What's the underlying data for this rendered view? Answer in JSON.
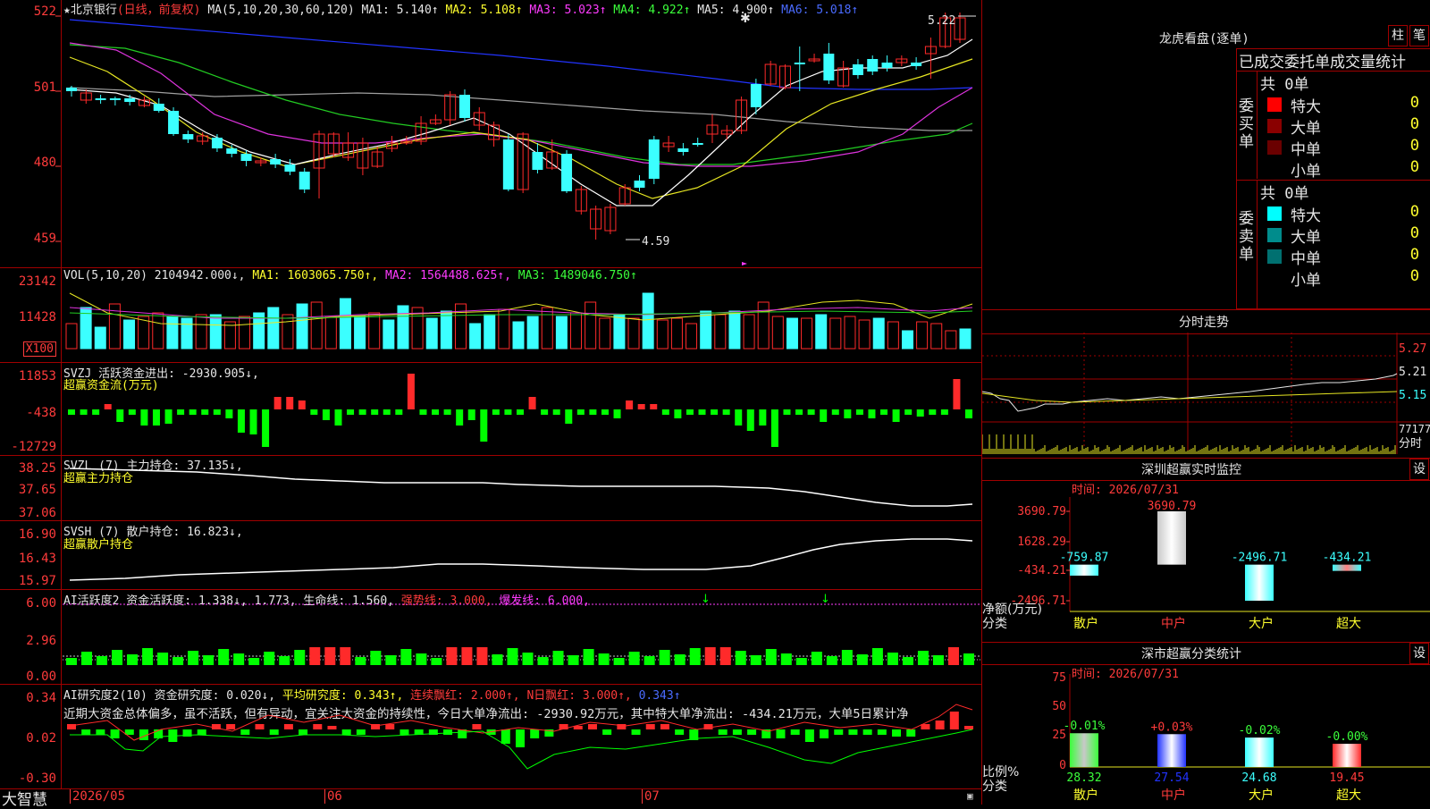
{
  "stock_header": {
    "star": "★",
    "name": "北京银行",
    "mode": "(日线，前复权)",
    "ma_label": "MA(5,10,20,30,60,120)",
    "ma1": "MA1: 5.140↑",
    "ma2": "MA2: 5.108↑",
    "ma3": "MA3: 5.023↑",
    "ma4": "MA4: 4.922↑",
    "ma5": "MA5: 4.900↑",
    "ma6": "MA6: 5.018↑",
    "high_mark": "5.22",
    "low_mark": "4.59"
  },
  "price_axis": [
    "522",
    "501",
    "480",
    "459"
  ],
  "vol_header": {
    "label": "VOL(5,10,20)",
    "value": "2104942.000↓,",
    "ma1": "MA1: 1603065.750↑,",
    "ma2": "MA2: 1564488.625↑,",
    "ma3": "MA3: 1489046.750↑"
  },
  "vol_axis": [
    "23142",
    "11428",
    "X100"
  ],
  "svzj_header": {
    "label": "SVZJ  活跃资金进出: -2930.905↓,",
    "sub": "超赢资金流(万元)"
  },
  "svzj_axis": [
    "11853",
    "-438",
    "-12729"
  ],
  "svzl_header": {
    "label": "SVZL (7) 主力持仓: 37.135↓,",
    "sub": "超赢主力持仓"
  },
  "svzl_axis": [
    "38.25",
    "37.65",
    "37.06"
  ],
  "svsh_header": {
    "label": "SVSH (7) 散户持仓: 16.823↓,",
    "sub": "超赢散户持仓"
  },
  "svsh_axis": [
    "16.90",
    "16.43",
    "15.97"
  ],
  "ai_active_header": {
    "label": "AI活跃度2 资金活跃度: 1.338↓,",
    "v2": "1.773,",
    "v3": "生命线: 1.560,",
    "v4": "强势线: 3.000,",
    "v5": "爆发线: 6.000,"
  },
  "ai_active_axis": [
    "6.00",
    "2.96",
    "0.00"
  ],
  "ai_research_header": {
    "label": "AI研究度2(10) 资金研究度: 0.020↓,",
    "v2": "平均研究度: 0.343↑,",
    "v3": "连续飘红: 2.000↑,",
    "v4": "N日飘红: 3.000↑,",
    "v5": "0.343↑"
  },
  "ai_research_text": "近期大资金总体偏多，虽不活跃，但有异动，宜关注大资金的持续性，今日大单净流出: -2930.92万元，其中特大单净流出: -434.21万元，大单5日累计净",
  "ai_research_axis": [
    "0.34",
    "0.02",
    "-0.30"
  ],
  "date_axis": {
    "brand": "大智慧",
    "d1": "2026/05",
    "d2": "06",
    "d3": "07"
  },
  "right_panel": {
    "lhb_title": "龙虎看盘(逐单)",
    "btn_zhu": "柱",
    "btn_bi": "笔",
    "stat_title": "已成交委托单成交量统计",
    "buy_total": "共 0单",
    "sell_total": "共 0单",
    "buy_label": "委买单",
    "sell_label": "委卖单",
    "buy_rows": [
      {
        "name": "特大",
        "num": "0",
        "pct": "0%",
        "color": "#ff0000"
      },
      {
        "name": "大单",
        "num": "0",
        "pct": "0%",
        "color": "#8a0000"
      },
      {
        "name": "中单",
        "num": "0",
        "pct": "0%",
        "color": "#6a0000"
      },
      {
        "name": "小单",
        "num": "0",
        "pct": "0%",
        "color": "#000000"
      }
    ],
    "sell_rows": [
      {
        "name": "特大",
        "num": "0",
        "pct": "0%",
        "color": "#00ffff"
      },
      {
        "name": "大单",
        "num": "0",
        "pct": "0%",
        "color": "#008c8c"
      },
      {
        "name": "中单",
        "num": "0",
        "pct": "0%",
        "color": "#007070"
      },
      {
        "name": "小单",
        "num": "0",
        "pct": "0%",
        "color": "#000000"
      }
    ],
    "intraday_title": "分时走势",
    "intraday_axis": [
      "5.27",
      "5.21",
      "5.15",
      "77177",
      "分时"
    ],
    "monitor_title": "深圳超赢实时监控",
    "monitor_btn": "设",
    "monitor_time": "时间: 2026/07/31",
    "monitor_axis": [
      "3690.79",
      "1628.29",
      "-434.21",
      "-2496.71"
    ],
    "monitor_ylabel": "净额(万元)",
    "monitor_xlabel": "分类",
    "monitor_cats": [
      "散户",
      "中户",
      "大户",
      "超大"
    ],
    "monitor_vals": [
      "-759.87",
      "3690.79",
      "-2496.71",
      "-434.21"
    ],
    "stats_title": "深市超赢分类统计",
    "stats_btn": "设",
    "stats_time": "时间: 2026/07/31",
    "stats_axis": [
      "75",
      "50",
      "25",
      "0"
    ],
    "stats_ylabel": "比例%",
    "stats_xlabel": "分类",
    "stats_cats": [
      "散户",
      "中户",
      "大户",
      "超大"
    ],
    "stats_changes": [
      "-0.01%",
      "+0.03%",
      "-0.02%",
      "-0.00%"
    ],
    "stats_vals": [
      "28.32",
      "27.54",
      "24.68",
      "19.45"
    ]
  },
  "colors": {
    "up": "#ff2a2a",
    "down": "#3bffff",
    "green": "#00ff00",
    "grid": "#a00000"
  }
}
